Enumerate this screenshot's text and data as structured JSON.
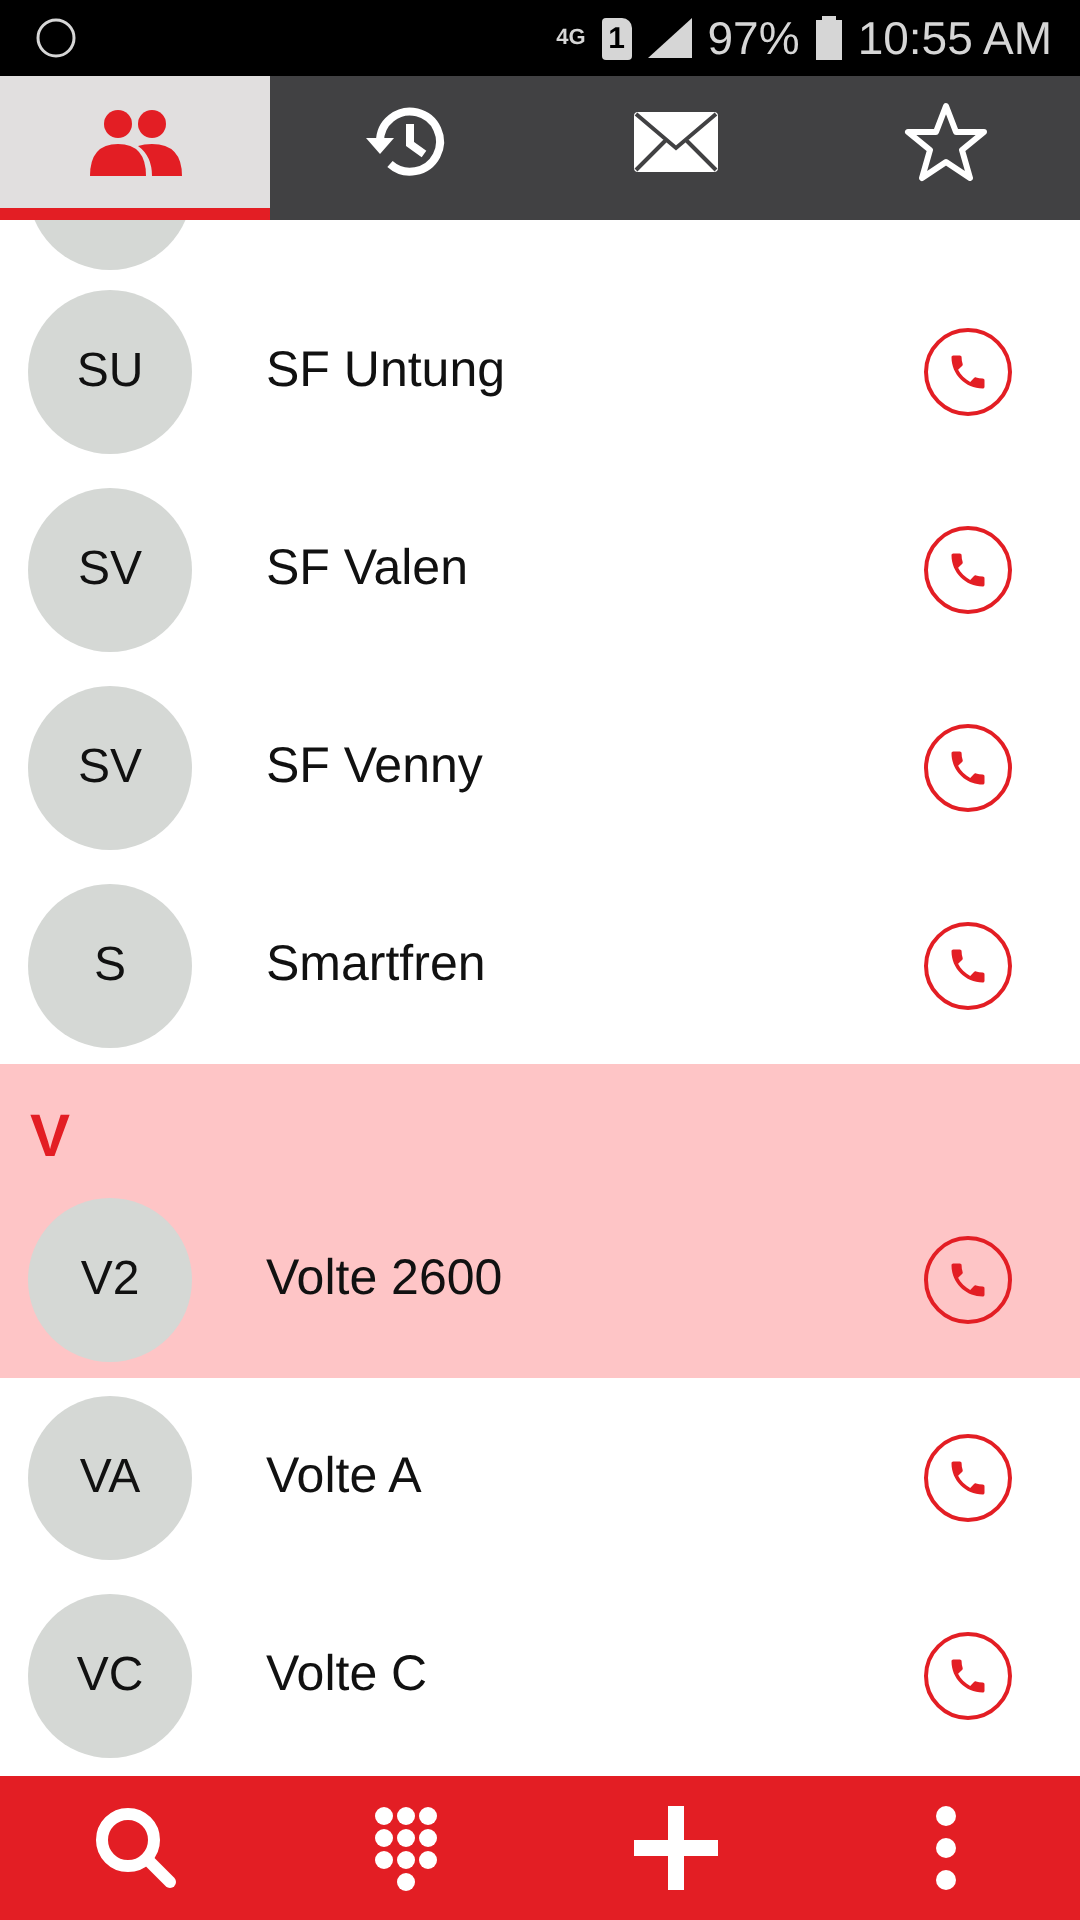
{
  "status_bar": {
    "network": "4G",
    "sim": "1",
    "battery": "97%",
    "time": "10:55 AM"
  },
  "tabs": [
    {
      "kind": "contacts",
      "selected": true
    },
    {
      "kind": "history",
      "selected": false
    },
    {
      "kind": "messages",
      "selected": false
    },
    {
      "kind": "favorites",
      "selected": false
    }
  ],
  "list": {
    "top_peek": true,
    "sections": [
      {
        "contacts": [
          {
            "initials": "SU",
            "name": "SF Untung",
            "selected": false
          },
          {
            "initials": "SV",
            "name": "SF Valen",
            "selected": false
          },
          {
            "initials": "SV",
            "name": "SF Venny",
            "selected": false
          },
          {
            "initials": "S",
            "name": "Smartfren",
            "selected": false
          }
        ]
      },
      {
        "letter": "V",
        "highlighted": true,
        "contacts": [
          {
            "initials": "V2",
            "name": "Volte 2600",
            "selected": true
          },
          {
            "initials": "VA",
            "name": "Volte A",
            "selected": false
          },
          {
            "initials": "VC",
            "name": "Volte C",
            "selected": false
          }
        ]
      }
    ]
  },
  "bottom_bar": [
    {
      "kind": "search"
    },
    {
      "kind": "dialpad"
    },
    {
      "kind": "add"
    },
    {
      "kind": "more"
    }
  ]
}
